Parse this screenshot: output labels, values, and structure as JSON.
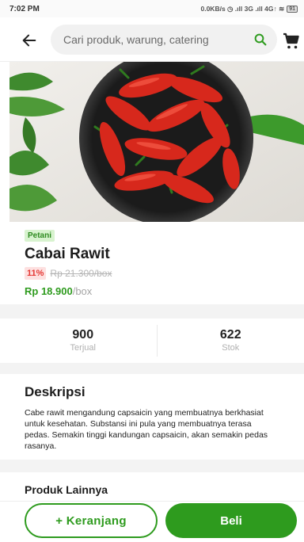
{
  "status_bar": {
    "time": "7:02 PM",
    "network": "0.0KB/s ◷ .ıll 3G .ıll 4G↑ ≋",
    "battery": "91"
  },
  "header": {
    "search_placeholder": "Cari produk, warung, catering",
    "back_icon": "arrow-left-icon",
    "search_icon": "search-icon",
    "cart_icon": "cart-icon"
  },
  "product": {
    "badge": "Petani",
    "name": "Cabai Rawit",
    "discount": "11%",
    "old_price": "Rp 21.300/box",
    "price": "Rp 18.900",
    "unit": "/box"
  },
  "stats": [
    {
      "value": "900",
      "label": "Terjual"
    },
    {
      "value": "622",
      "label": "Stok"
    }
  ],
  "description": {
    "title": "Deskripsi",
    "text": "Cabe rawit mengandung capsaicin yang membuatnya berkhasiat untuk kesehatan. Substansi ini pula yang membuatnya terasa pedas. Semakin tinggi kandungan capsaicin, akan semakin pedas rasanya."
  },
  "other_products": {
    "title": "Produk Lainnya"
  },
  "actions": {
    "add_to_cart": "+ Keranjang",
    "buy": "Beli"
  },
  "colors": {
    "accent": "#2e9b1e",
    "discount": "#e53935"
  }
}
